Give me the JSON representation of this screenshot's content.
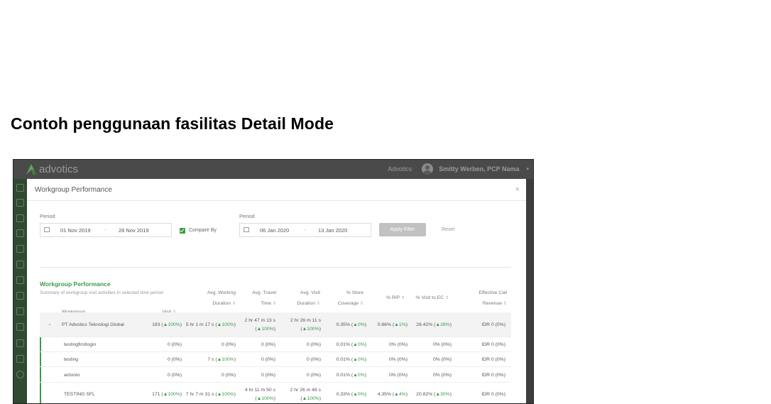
{
  "heading": "Contoh penggunaan fasilitas Detail Mode",
  "app": {
    "logo_text": "advotics",
    "org": "Advotics",
    "user": "Smitty Werben, PCP Nama",
    "user_caret": "▾"
  },
  "modal": {
    "title": "Workgroup Performance",
    "close": "×",
    "period1": {
      "label": "Period",
      "start": "01 Nov 2019",
      "sep": "-",
      "end": "28 Nov 2019"
    },
    "compare_label": "Compare By",
    "period2": {
      "label": "Period",
      "start": "06 Jan 2020",
      "sep": "-",
      "end": "13 Jan 2020"
    },
    "apply_label": "Apply Filter",
    "reset_label": "Reset",
    "section_title": "Workgroup Performance",
    "section_subtitle": "Summary of workgroup visit activities in selected time period"
  },
  "table": {
    "headers": [
      {
        "l1": "",
        "l2": "Workgroup"
      },
      {
        "l1": "",
        "l2": "Visit"
      },
      {
        "l1": "Avg. Working",
        "l2": "Duration"
      },
      {
        "l1": "Avg. Travel",
        "l2": "Time"
      },
      {
        "l1": "Avg. Visit",
        "l2": "Duration"
      },
      {
        "l1": "% Store",
        "l2": "Coverage"
      },
      {
        "l1": "",
        "l2": "% RIP"
      },
      {
        "l1": "",
        "l2": "% Visit to EC"
      },
      {
        "l1": "Effective Call",
        "l2": "Revenue"
      }
    ],
    "group": {
      "chevron": "⌄",
      "name": "PT Advotics Teknologi Global",
      "visit": "183 (",
      "visit_up": "▲100%",
      "visit_end": ")",
      "work": "5 hr 1 m 17 s (",
      "work_up": "▲100%",
      "work_end": ")",
      "travel1": "2 hr 47 m 13 s",
      "travel2_pre": "(",
      "travel2_up": "▲100%",
      "travel2_end": ")",
      "vdur1": "2 hr 26 m 11 s",
      "vdur2_pre": "(",
      "vdur2_up": "▲100%",
      "vdur2_end": ")",
      "cov": "0.35% (",
      "cov_up": "▲0%",
      "cov_end": ")",
      "rip": "0.86% (",
      "rip_up": "▲1%",
      "rip_end": ")",
      "ec": "28.42% (",
      "ec_up": "▲28%",
      "ec_end": ")",
      "rev": "IDR 0 (0%)"
    },
    "rows": [
      {
        "name": "testingfirstlogin",
        "visit": "0 (0%)",
        "work": "0 (0%)",
        "travel": "0 (0%)",
        "vdur": "0 (0%)",
        "cov": "0.01% (",
        "cov_up": "▲0%",
        "cov_end": ")",
        "rip": "0% (0%)",
        "ec": "0% (0%)",
        "rev": "IDR 0 (0%)"
      },
      {
        "name": "testing",
        "visit": "0 (0%)",
        "work": "7 s (",
        "work_up": "▲100%",
        "work_end": ")",
        "travel": "0 (0%)",
        "vdur": "0 (0%)",
        "cov": "0.01% (",
        "cov_up": "▲0%",
        "cov_end": ")",
        "rip": "0% (0%)",
        "ec": "0% (0%)",
        "rev": "IDR 0 (0%)"
      },
      {
        "name": "antonio",
        "visit": "0 (0%)",
        "work": "0 (0%)",
        "travel": "0 (0%)",
        "vdur": "0 (0%)",
        "cov": "0.01% (",
        "cov_up": "▲0%",
        "cov_end": ")",
        "rip": "0% (0%)",
        "ec": "0% (0%)",
        "rev": "IDR 0 (0%)"
      }
    ],
    "last": {
      "name": "TESTING SFL",
      "visit": "171 (",
      "visit_up": "▲100%",
      "visit_end": ")",
      "work": "7 hr 7 m 31 s (",
      "work_up": "▲100%",
      "work_end": ")",
      "travel1": "4 hr 11 m 50 s",
      "travel2_pre": "(",
      "travel2_up": "▲100%",
      "travel2_end": ")",
      "vdur1": "2 hr 26 m 48 s",
      "vdur2_pre": "(",
      "vdur2_up": "▲100%",
      "vdur2_end": ")",
      "cov": "0.33% (",
      "cov_up": "▲0%",
      "cov_end": ")",
      "rip": "4.35% (",
      "rip_up": "▲4%",
      "rip_end": ")",
      "ec": "20.82% (",
      "ec_up": "▲30%",
      "ec_end": ")",
      "rev": "IDR 0 (0%)"
    }
  }
}
